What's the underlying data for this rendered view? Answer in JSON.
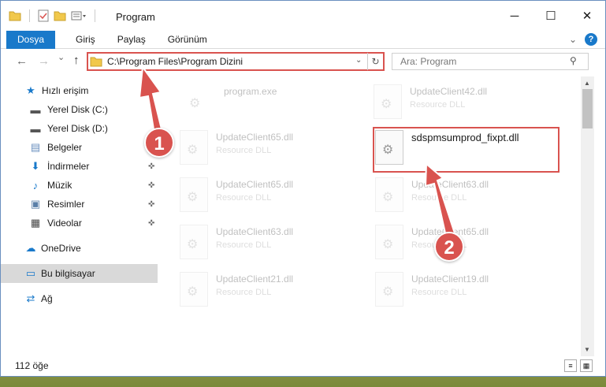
{
  "window": {
    "title": "Program",
    "qat_icons": [
      "folder-icon",
      "properties-icon",
      "new-folder-icon",
      "customize-icon"
    ],
    "controls": {
      "minimize": "─",
      "maximize": "☐",
      "close": "✕"
    }
  },
  "ribbon": {
    "tabs": [
      "Dosya",
      "Giriş",
      "Paylaş",
      "Görünüm"
    ],
    "expand": "⌄",
    "help": "?"
  },
  "navigation": {
    "back": "←",
    "forward": "→",
    "recent": "⌄",
    "up": "↑",
    "address": "C:\\Program Files\\Program Dizini",
    "address_chevron": "⌄",
    "refresh": "↻",
    "search_placeholder": "Ara: Program",
    "search_icon": "⚲"
  },
  "sidebar": {
    "items": [
      {
        "label": "Hızlı erişim",
        "icon": "★",
        "pinned": false
      },
      {
        "label": "Yerel Disk (C:)",
        "icon": "▬",
        "pinned": false
      },
      {
        "label": "Yerel Disk (D:)",
        "icon": "▬",
        "pinned": false
      },
      {
        "label": "Belgeler",
        "icon": "▤",
        "pinned": false
      },
      {
        "label": "İndirmeler",
        "icon": "⬇",
        "pinned": true
      },
      {
        "label": "Müzik",
        "icon": "♪",
        "pinned": true
      },
      {
        "label": "Resimler",
        "icon": "▣",
        "pinned": true
      },
      {
        "label": "Videolar",
        "icon": "▦",
        "pinned": true
      },
      {
        "label": "OneDrive",
        "icon": "☁",
        "pinned": false
      },
      {
        "label": "Bu bilgisayar",
        "icon": "▭",
        "pinned": false
      },
      {
        "label": "Ağ",
        "icon": "⇄",
        "pinned": false
      }
    ],
    "pin_glyph": "✜"
  },
  "files": [
    {
      "name": "program.exe",
      "type": "",
      "faded": true
    },
    {
      "name": "UpdateClient42.dll",
      "type": "Resource DLL",
      "faded": true
    },
    {
      "name": "UpdateClient65.dll",
      "type": "Resource DLL",
      "faded": true
    },
    {
      "name": "sdspmsumprod_fixpt.dll",
      "type": "",
      "faded": false
    },
    {
      "name": "UpdateClient65.dll",
      "type": "Resource DLL",
      "faded": true
    },
    {
      "name": "UpdateClient63.dll",
      "type": "Resource DLL",
      "faded": true
    },
    {
      "name": "UpdateClient63.dll",
      "type": "Resource DLL",
      "faded": true
    },
    {
      "name": "UpdateClient65.dll",
      "type": "Resource DLL",
      "faded": true
    },
    {
      "name": "UpdateClient21.dll",
      "type": "Resource DLL",
      "faded": true
    },
    {
      "name": "UpdateClient19.dll",
      "type": "Resource DLL",
      "faded": true
    }
  ],
  "scroll": {
    "up": "▲",
    "down": "▼"
  },
  "status": {
    "count": "112 öğe",
    "details_view": "≡",
    "icons_view": "▦"
  },
  "callouts": [
    "1",
    "2"
  ],
  "colors": {
    "accent": "#1979ca",
    "annotation": "#d9534f"
  }
}
